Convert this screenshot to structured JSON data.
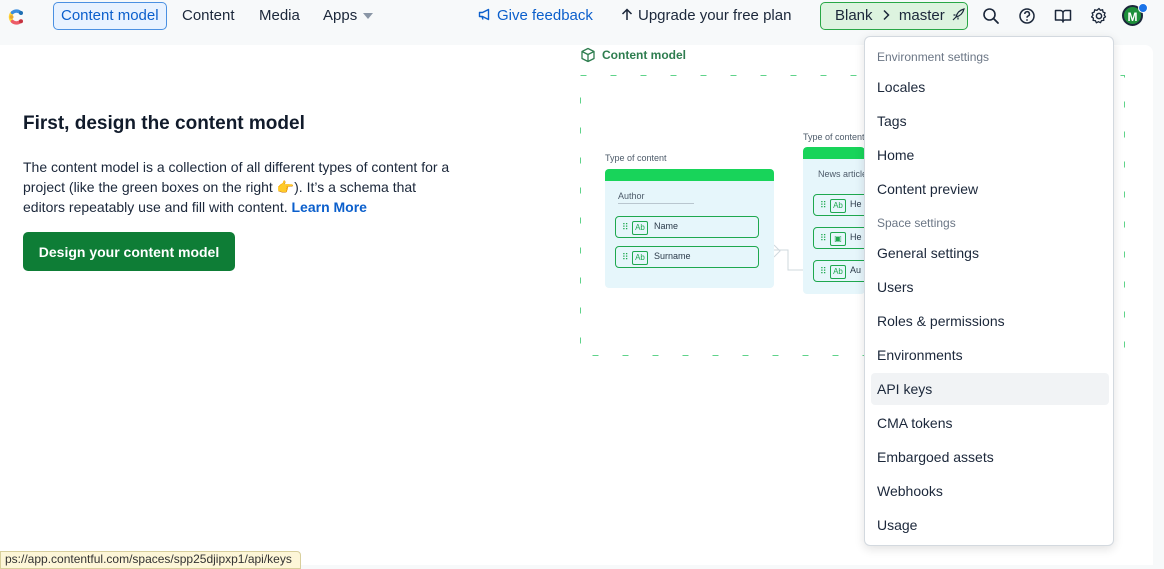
{
  "topbar": {
    "tabs": [
      {
        "label": "Content model",
        "active": true
      },
      {
        "label": "Content"
      },
      {
        "label": "Media"
      },
      {
        "label": "Apps"
      }
    ],
    "feedback": "Give feedback",
    "upgrade": "Upgrade your free plan",
    "env": {
      "space": "Blank",
      "environment": "master"
    },
    "avatar_initial": "M"
  },
  "hero": {
    "title": "First, design the content model",
    "text": "The content model is a collection of all different types of content for a project (like the green boxes on the right 👉). It’s a schema that editors repeatably use and fill with content.",
    "learn_more": "Learn More",
    "cta": "Design your content model"
  },
  "illustration": {
    "label": "Content model",
    "card1": {
      "type_label": "Type of content",
      "name": "Author",
      "fields": [
        "Name",
        "Surname"
      ]
    },
    "card2": {
      "type_label": "Type of content",
      "name": "News article",
      "fields": [
        "He",
        "He",
        "Au"
      ]
    }
  },
  "menu": {
    "env_header": "Environment settings",
    "env_items": [
      "Locales",
      "Tags",
      "Home",
      "Content preview"
    ],
    "space_header": "Space settings",
    "space_items": [
      "General settings",
      "Users",
      "Roles & permissions",
      "Environments",
      "API keys",
      "CMA tokens",
      "Embargoed assets",
      "Webhooks",
      "Usage"
    ]
  },
  "status_url": "ps://app.contentful.com/spaces/spp25djipxp1/api/keys",
  "colors": {
    "accent": "#0b5fcc",
    "brand_green": "#0e7d36",
    "env_green": "#ddf3df"
  }
}
